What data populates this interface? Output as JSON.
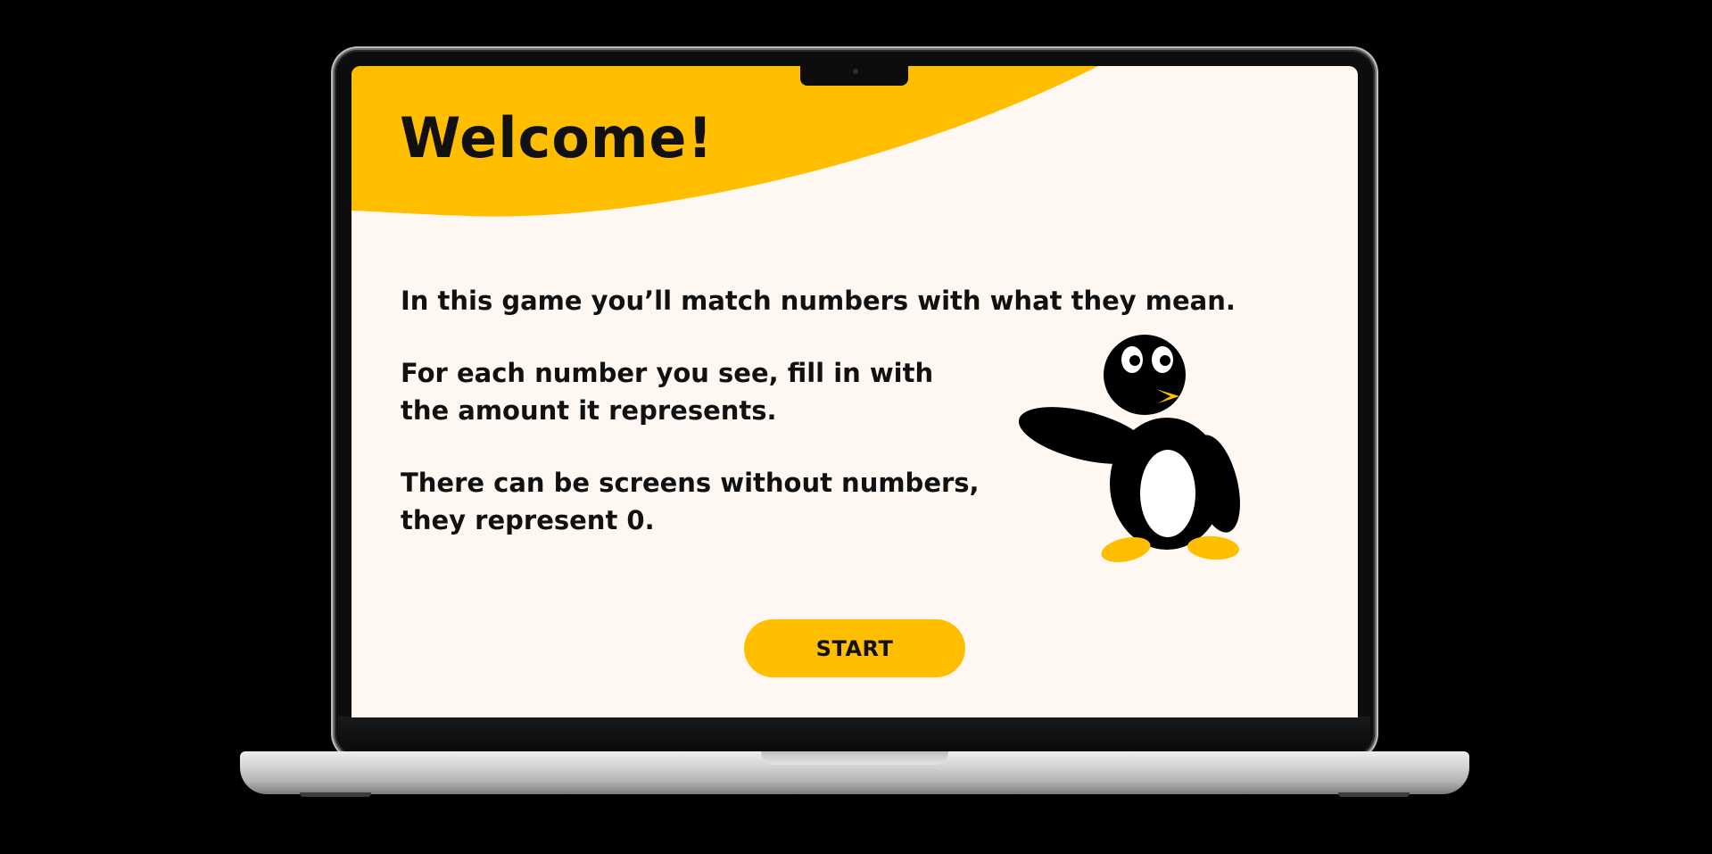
{
  "colors": {
    "accent": "#ffbf00",
    "background": "#fff7f2",
    "text": "#111111",
    "device_frame": "#0d0d0d"
  },
  "welcome": {
    "title": "Welcome!",
    "intro": "In this game you’ll match numbers with what they mean.",
    "instruction_line1": "For each number you see, fill in with",
    "instruction_line2": "the amount it represents.",
    "note_line1": "There can be screens without numbers,",
    "note_line2": "they represent 0."
  },
  "actions": {
    "start_label": "START"
  },
  "icons": {
    "mascot": "penguin-mascot-icon"
  }
}
